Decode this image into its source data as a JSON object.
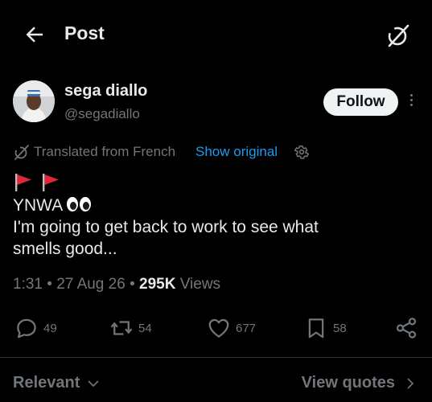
{
  "header": {
    "title": "Post",
    "back_icon": "arrow-left-icon",
    "grok_icon": "grok-icon"
  },
  "author": {
    "display_name": "sega diallo",
    "handle": "@segadiallo",
    "follow_label": "Follow"
  },
  "translation": {
    "label": "Translated from French",
    "show_original": "Show original",
    "link_color": "#1d9bf0"
  },
  "post": {
    "flag_emoji": "red triangular flag",
    "flag_count": 2,
    "line1": "YNWA",
    "eyes_emoji": "eyes",
    "line2": "I'm going to get back to work to see what",
    "line3": "smells good..."
  },
  "meta": {
    "time": "1:31",
    "separator": " • ",
    "date": "27 Aug 26",
    "views_count": "295K",
    "views_label": " Views"
  },
  "actions": {
    "replies": "49",
    "reposts": "54",
    "likes": "677",
    "bookmarks": "58"
  },
  "bottom": {
    "sort_label": "Relevant",
    "view_quotes": "View quotes"
  },
  "colors": {
    "background": "#000000",
    "primary_text": "#e7e9ea",
    "secondary_text": "#71767b",
    "divider": "#2f3336"
  }
}
